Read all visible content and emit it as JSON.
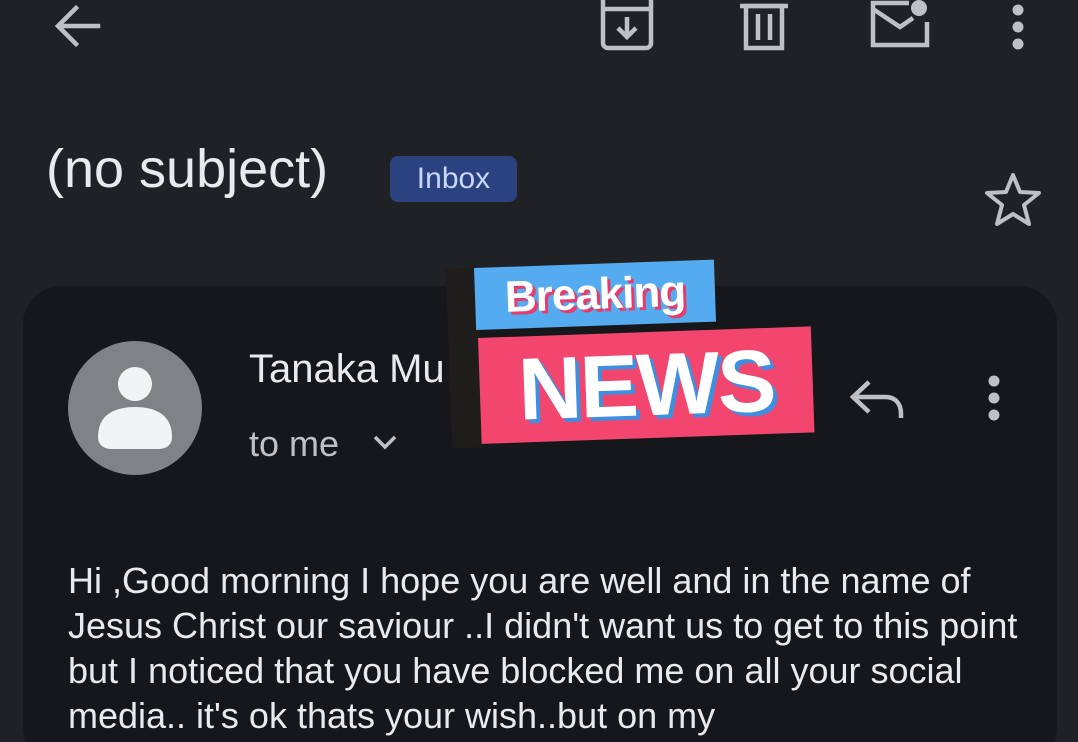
{
  "toolbar": {
    "back_icon": "arrow-left-icon",
    "archive_icon": "archive-icon",
    "delete_icon": "trash-icon",
    "mark_unread_icon": "mark-unread-icon",
    "more_icon": "more-vert-icon"
  },
  "email": {
    "subject": "(no subject)",
    "label": "Inbox",
    "star_icon": "star-outline-icon"
  },
  "message": {
    "sender": "Tanaka Mu",
    "recipient": "to me",
    "body": "Hi ,Good morning I hope you are well and in the name of Jesus Christ our saviour ..I didn't want us to get to this point but I noticed that you have blocked me on all your social media.. it's ok thats your wish..but on my"
  },
  "sticker": {
    "top_text": "Breaking",
    "bottom_text": "NEWS"
  },
  "colors": {
    "background": "#202124",
    "card": "#16171a",
    "label_chip": "#2a4380",
    "sticker_blue": "#54abef",
    "sticker_pink": "#f2466f"
  }
}
